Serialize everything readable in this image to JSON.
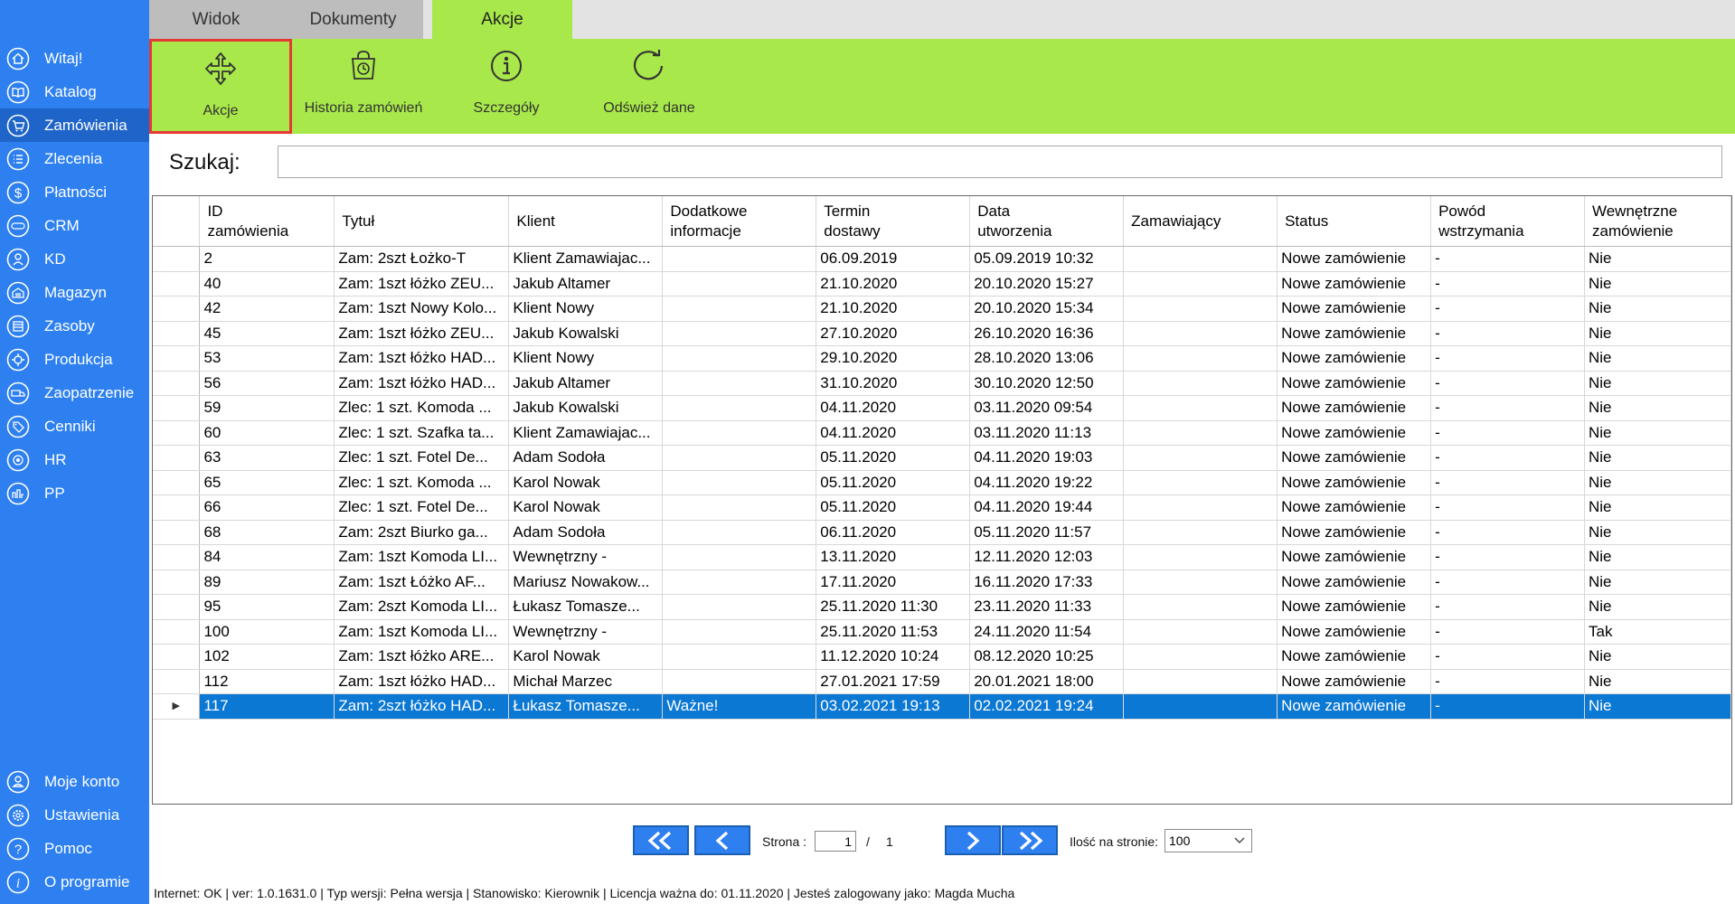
{
  "sidebar": {
    "items": [
      {
        "label": "Witaj!",
        "icon": "home-icon"
      },
      {
        "label": "Katalog",
        "icon": "book-icon"
      },
      {
        "label": "Zamówienia",
        "icon": "cart-icon"
      },
      {
        "label": "Zlecenia",
        "icon": "list-icon"
      },
      {
        "label": "Płatności",
        "icon": "dollar-icon"
      },
      {
        "label": "CRM",
        "icon": "crm-icon"
      },
      {
        "label": "KD",
        "icon": "kd-icon"
      },
      {
        "label": "Magazyn",
        "icon": "warehouse-icon"
      },
      {
        "label": "Zasoby",
        "icon": "resources-icon"
      },
      {
        "label": "Produkcja",
        "icon": "production-icon"
      },
      {
        "label": "Zaopatrzenie",
        "icon": "truck-icon"
      },
      {
        "label": "Cenniki",
        "icon": "price-tag-icon"
      },
      {
        "label": "HR",
        "icon": "hr-icon"
      },
      {
        "label": "PP",
        "icon": "pp-icon"
      }
    ],
    "active_index": 2,
    "bottom_items": [
      {
        "label": "Moje konto",
        "icon": "user-icon"
      },
      {
        "label": "Ustawienia",
        "icon": "settings-icon"
      },
      {
        "label": "Pomoc",
        "icon": "help-icon"
      },
      {
        "label": "O programie",
        "icon": "info-icon"
      }
    ]
  },
  "tabs": [
    {
      "label": "Widok"
    },
    {
      "label": "Dokumenty"
    },
    {
      "label": "Akcje"
    }
  ],
  "active_tab": 2,
  "ribbon": {
    "buttons": [
      {
        "label": "Akcje",
        "icon": "move-arrows-icon"
      },
      {
        "label": "Historia zamówień",
        "icon": "history-bag-icon"
      },
      {
        "label": "Szczegóły",
        "icon": "info-circle-icon"
      },
      {
        "label": "Odśwież dane",
        "icon": "refresh-icon"
      }
    ],
    "selected_index": 0
  },
  "search": {
    "label": "Szukaj:",
    "value": ""
  },
  "table": {
    "columns": [
      {
        "label": "ID\nzamówienia"
      },
      {
        "label": "Tytuł"
      },
      {
        "label": "Klient"
      },
      {
        "label": "Dodatkowe\ninformacje"
      },
      {
        "label": "Termin\ndostawy"
      },
      {
        "label": "Data\nutworzenia"
      },
      {
        "label": "Zamawiający"
      },
      {
        "label": "Status"
      },
      {
        "label": "Powód\nwstrzymania"
      },
      {
        "label": "Wewnętrzne\nzamówienie"
      }
    ],
    "rows": [
      [
        "2",
        "Zam: 2szt Łożko-T",
        "Klient Zamawiajac...",
        "",
        "06.09.2019",
        "05.09.2019 10:32",
        "",
        "Nowe zamówienie",
        "-",
        "Nie"
      ],
      [
        "40",
        "Zam: 1szt łóżko ZEU...",
        "Jakub  Altamer",
        "",
        "21.10.2020",
        "20.10.2020 15:27",
        "",
        "Nowe zamówienie",
        "-",
        "Nie"
      ],
      [
        "42",
        "Zam: 1szt Nowy Kolo...",
        "Klient Nowy",
        "",
        "21.10.2020",
        "20.10.2020 15:34",
        "",
        "Nowe zamówienie",
        "-",
        "Nie"
      ],
      [
        "45",
        "Zam: 1szt łóżko ZEU...",
        "Jakub Kowalski",
        "",
        "27.10.2020",
        "26.10.2020 16:36",
        "",
        "Nowe zamówienie",
        "-",
        "Nie"
      ],
      [
        "53",
        "Zam: 1szt łóżko HAD...",
        "Klient Nowy",
        "",
        "29.10.2020",
        "28.10.2020 13:06",
        "",
        "Nowe zamówienie",
        "-",
        "Nie"
      ],
      [
        "56",
        "Zam: 1szt łóżko HAD...",
        "Jakub  Altamer",
        "",
        "31.10.2020",
        "30.10.2020 12:50",
        "",
        "Nowe zamówienie",
        "-",
        "Nie"
      ],
      [
        "59",
        "Zlec: 1 szt. Komoda ...",
        "Jakub Kowalski",
        "",
        "04.11.2020",
        "03.11.2020 09:54",
        "",
        "Nowe zamówienie",
        "-",
        "Nie"
      ],
      [
        "60",
        "Zlec: 1 szt. Szafka ta...",
        "Klient Zamawiajac...",
        "",
        "04.11.2020",
        "03.11.2020 11:13",
        "",
        "Nowe zamówienie",
        "-",
        "Nie"
      ],
      [
        "63",
        "Zlec: 1 szt. Fotel De...",
        "Adam Sodoła",
        "",
        "05.11.2020",
        "04.11.2020 19:03",
        "",
        "Nowe zamówienie",
        "-",
        "Nie"
      ],
      [
        "65",
        "Zlec: 1 szt. Komoda ...",
        "Karol Nowak",
        "",
        "05.11.2020",
        "04.11.2020 19:22",
        "",
        "Nowe zamówienie",
        "-",
        "Nie"
      ],
      [
        "66",
        "Zlec: 1 szt. Fotel De...",
        "Karol Nowak",
        "",
        "05.11.2020",
        "04.11.2020 19:44",
        "",
        "Nowe zamówienie",
        "-",
        "Nie"
      ],
      [
        "68",
        "Zam: 2szt Biurko ga...",
        "Adam Sodoła",
        "",
        "06.11.2020",
        "05.11.2020 11:57",
        "",
        "Nowe zamówienie",
        "-",
        "Nie"
      ],
      [
        "84",
        "Zam: 1szt Komoda LI...",
        "Wewnętrzny -",
        "",
        "13.11.2020",
        "12.11.2020 12:03",
        "",
        "Nowe zamówienie",
        "-",
        "Nie"
      ],
      [
        "89",
        "Zam: 1szt Łóżko AF...",
        "Mariusz Nowakow...",
        "",
        "17.11.2020",
        "16.11.2020 17:33",
        "",
        "Nowe zamówienie",
        "-",
        "Nie"
      ],
      [
        "95",
        "Zam: 2szt Komoda LI...",
        "Łukasz Tomasze...",
        "",
        "25.11.2020 11:30",
        "23.11.2020 11:33",
        "",
        "Nowe zamówienie",
        "-",
        "Nie"
      ],
      [
        "100",
        "Zam: 1szt Komoda LI...",
        "Wewnętrzny -",
        "",
        "25.11.2020 11:53",
        "24.11.2020 11:54",
        "",
        "Nowe zamówienie",
        "-",
        "Tak"
      ],
      [
        "102",
        "Zam: 1szt łóżko ARE...",
        "Karol Nowak",
        "",
        "11.12.2020 10:24",
        "08.12.2020 10:25",
        "",
        "Nowe zamówienie",
        "-",
        "Nie"
      ],
      [
        "112",
        "Zam: 1szt łóżko HAD...",
        "Michał Marzec",
        "",
        "27.01.2021 17:59",
        "20.01.2021 18:00",
        "",
        "Nowe zamówienie",
        "-",
        "Nie"
      ],
      [
        "117",
        "Zam: 2szt łóżko HAD...",
        "Łukasz Tomasze...",
        "Ważne!",
        "03.02.2021 19:13",
        "02.02.2021 19:24",
        "",
        "Nowe zamówienie",
        "-",
        "Nie"
      ]
    ],
    "selected_row": 18
  },
  "pager": {
    "page_label": "Strona :",
    "current_page": "1",
    "separator": "/",
    "total_pages": "1",
    "per_page_label": "Ilość na stronie:",
    "per_page_value": "100"
  },
  "status_bar": {
    "text": "Internet: OK  |   ver: 1.0.1631.0   |   Typ wersji: Pełna wersja   |   Stanowisko: Kierownik   |   Licencja ważna do: 01.11.2020  |   Jesteś zalogowany jako: Magda Mucha"
  },
  "colors": {
    "sidebar": "#2e80f0",
    "ribbon": "#a8e84a",
    "selection": "#0b78d4",
    "highlight_border": "#e53935"
  }
}
